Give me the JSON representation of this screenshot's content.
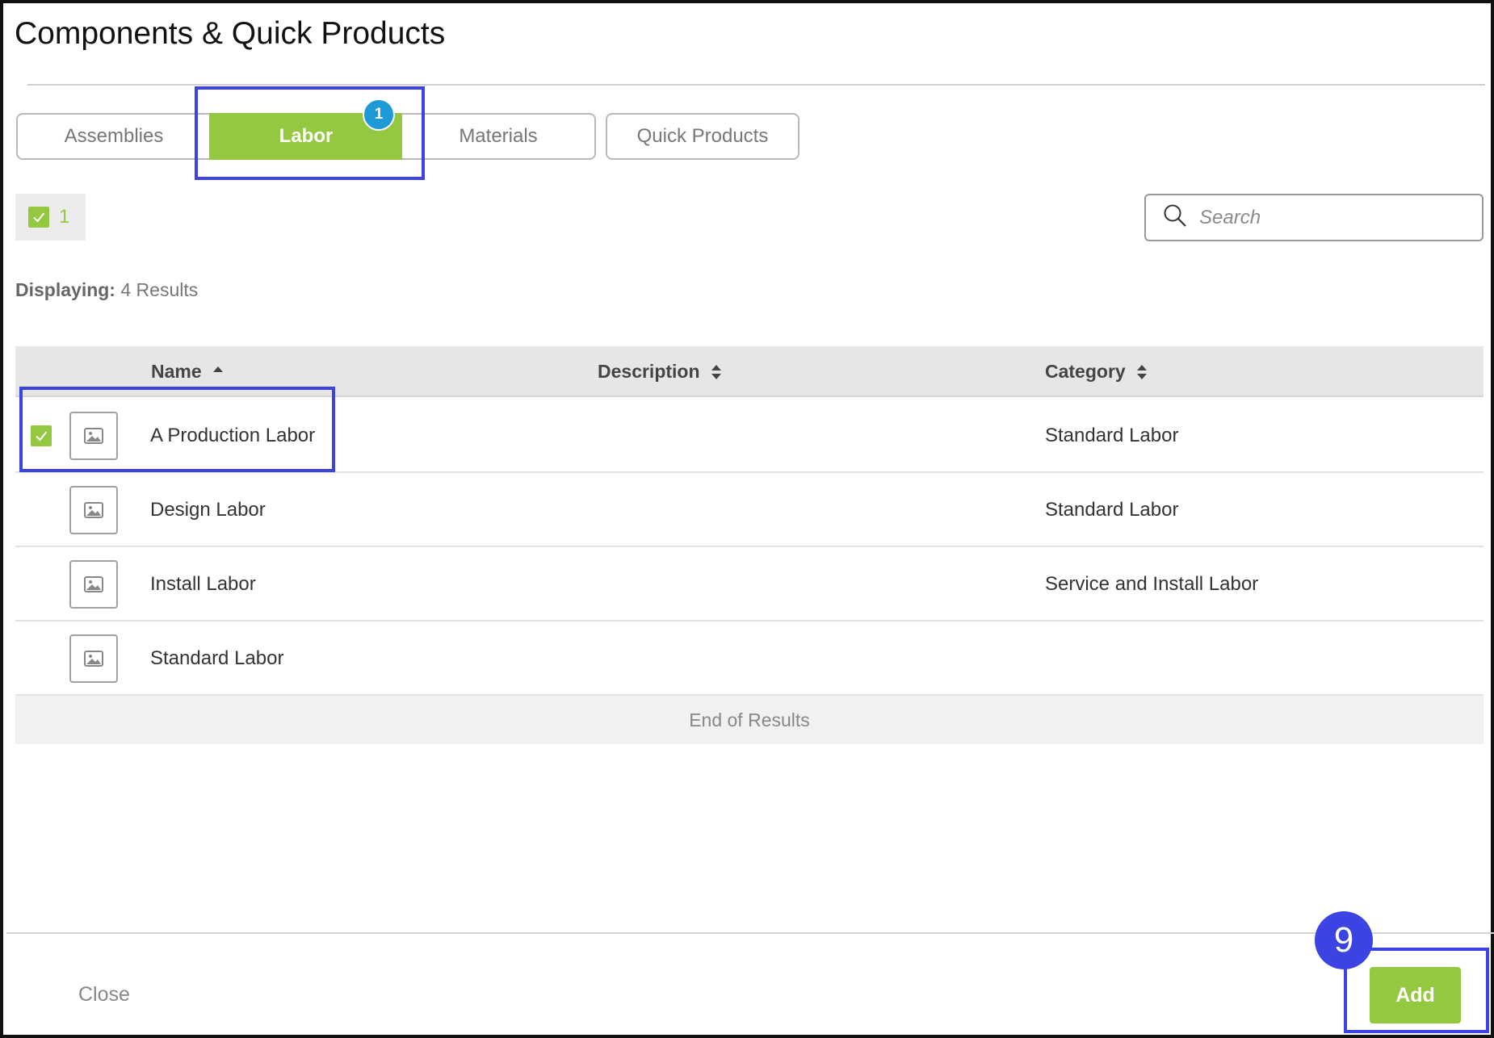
{
  "dialog": {
    "title": "Components & Quick Products"
  },
  "tabs": [
    {
      "label": "Assemblies",
      "active": false
    },
    {
      "label": "Labor",
      "active": true,
      "badge": "1"
    },
    {
      "label": "Materials",
      "active": false
    },
    {
      "label": "Quick Products",
      "active": false
    }
  ],
  "selection": {
    "count": "1"
  },
  "search": {
    "placeholder": "Search",
    "value": ""
  },
  "results": {
    "label": "Displaying:",
    "count_text": "4 Results"
  },
  "table": {
    "columns": [
      {
        "label": "Name",
        "sort": "ascending"
      },
      {
        "label": "Description",
        "sort": "none"
      },
      {
        "label": "Category",
        "sort": "none"
      }
    ],
    "rows": [
      {
        "name": "A Production Labor",
        "description": "",
        "category": "Standard Labor",
        "selected": true
      },
      {
        "name": "Design Labor",
        "description": "",
        "category": "Standard Labor",
        "selected": false
      },
      {
        "name": "Install Labor",
        "description": "",
        "category": "Service and Install Labor",
        "selected": false
      },
      {
        "name": "Standard Labor",
        "description": "",
        "category": "",
        "selected": false
      }
    ],
    "end_text": "End of Results"
  },
  "footer": {
    "close_label": "Close",
    "add_label": "Add"
  },
  "annotation": {
    "step": "9"
  },
  "colors": {
    "accent_green": "#94c840",
    "badge_blue": "#1e9ad6",
    "annotation_blue": "#3b43e3"
  },
  "icons": {
    "search": "search-icon",
    "thumbnail": "image-placeholder-icon",
    "checkbox": "checkmark-icon",
    "sort": "sort-icon"
  }
}
